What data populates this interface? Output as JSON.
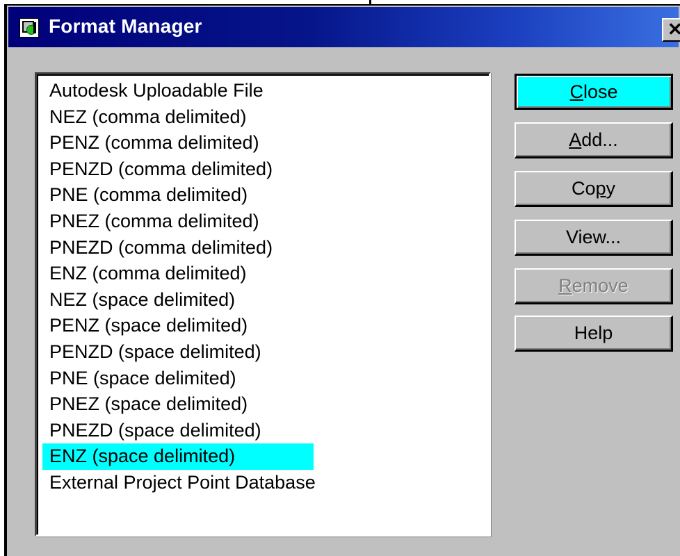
{
  "window": {
    "title": "Format Manager",
    "close_glyph": "✕"
  },
  "formats": {
    "items": [
      "Autodesk Uploadable File",
      "NEZ (comma delimited)",
      "PENZ (comma delimited)",
      "PENZD (comma delimited)",
      "PNE (comma delimited)",
      "PNEZ (comma delimited)",
      "PNEZD (comma delimited)",
      "ENZ (comma delimited)",
      "NEZ (space delimited)",
      "PENZ (space delimited)",
      "PENZD (space delimited)",
      "PNE (space delimited)",
      "PNEZ (space delimited)",
      "PNEZD (space delimited)",
      "ENZ (space delimited)",
      "External Project Point Database"
    ],
    "selected_index": 14
  },
  "buttons": {
    "close": {
      "label": "Close",
      "mnemonic": "C",
      "rest": "lose"
    },
    "add": {
      "label": "Add...",
      "mnemonic": "A",
      "rest": "dd..."
    },
    "copy": {
      "label": "Copy",
      "pre": "Co",
      "mnemonic": "p",
      "rest": "y"
    },
    "view": {
      "label": "View...",
      "mnemonic": "",
      "rest": "View..."
    },
    "remove": {
      "label": "Remove",
      "mnemonic": "R",
      "rest": "emove",
      "disabled": true
    },
    "help": {
      "label": "Help",
      "mnemonic": "",
      "rest": "Help"
    }
  },
  "colors": {
    "selection": "#00ffff",
    "default_button": "#00ffff",
    "titlebar_start": "#00007a",
    "titlebar_end": "#3a6fe0",
    "dialog_face": "#c0c0c0"
  },
  "icons": {
    "app_icon": "format-manager-app-icon",
    "close_icon": "close-x-icon"
  }
}
